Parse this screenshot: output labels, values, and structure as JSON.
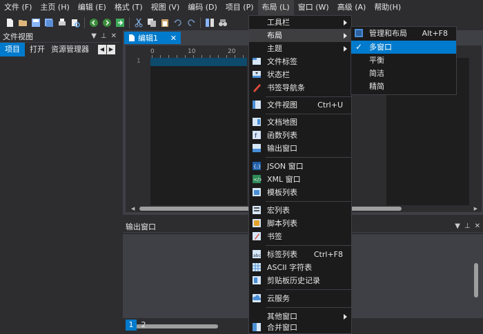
{
  "menubar": [
    {
      "label": "文件 (F)"
    },
    {
      "label": "主页 (H)"
    },
    {
      "label": "编辑 (E)"
    },
    {
      "label": "格式 (T)"
    },
    {
      "label": "视图 (V)"
    },
    {
      "label": "编码 (D)"
    },
    {
      "label": "项目 (P)"
    },
    {
      "label": "布局 (L)"
    },
    {
      "label": "窗口 (W)"
    },
    {
      "label": "高级 (A)"
    },
    {
      "label": "帮助(H)"
    }
  ],
  "file_view": {
    "title": "文件视图",
    "tabs": [
      "项目",
      "打开",
      "资源管理器"
    ]
  },
  "editor": {
    "tab_label": "编辑1",
    "ruler": [
      "0",
      "10",
      "20"
    ],
    "line_numbers": [
      "1"
    ]
  },
  "output": {
    "title": "输出窗口",
    "tabs": [
      "1",
      "2"
    ]
  },
  "layout_menu": {
    "items": [
      {
        "label": "工具栏",
        "shortcut": "",
        "submenu": true,
        "icon": "none"
      },
      {
        "label": "布局",
        "shortcut": "",
        "submenu": true,
        "icon": "none"
      },
      {
        "label": "主题",
        "shortcut": "",
        "submenu": true,
        "icon": "none"
      },
      {
        "label": "文件标签",
        "shortcut": "",
        "submenu": false,
        "icon": "file-tabs-icon"
      },
      {
        "label": "状态栏",
        "shortcut": "",
        "submenu": false,
        "icon": "status-bar-icon"
      },
      {
        "label": "书签导航条",
        "shortcut": "",
        "submenu": false,
        "icon": "bookmark-nav-icon"
      },
      {
        "label": "文件视图",
        "shortcut": "Ctrl+U",
        "submenu": false,
        "icon": "file-view-icon"
      },
      {
        "label": "文档地图",
        "shortcut": "",
        "submenu": false,
        "icon": "document-map-icon"
      },
      {
        "label": "函数列表",
        "shortcut": "",
        "submenu": false,
        "icon": "function-list-icon"
      },
      {
        "label": "输出窗口",
        "shortcut": "",
        "submenu": false,
        "icon": "output-window-icon"
      },
      {
        "label": "JSON 窗口",
        "shortcut": "",
        "submenu": false,
        "icon": "json-icon"
      },
      {
        "label": "XML 窗口",
        "shortcut": "",
        "submenu": false,
        "icon": "xml-icon"
      },
      {
        "label": "模板列表",
        "shortcut": "",
        "submenu": false,
        "icon": "template-list-icon"
      },
      {
        "label": "宏列表",
        "shortcut": "",
        "submenu": false,
        "icon": "macro-list-icon"
      },
      {
        "label": "脚本列表",
        "shortcut": "",
        "submenu": false,
        "icon": "script-list-icon"
      },
      {
        "label": "书签",
        "shortcut": "",
        "submenu": false,
        "icon": "bookmark-icon"
      },
      {
        "label": "标签列表",
        "shortcut": "Ctrl+F8",
        "submenu": false,
        "icon": "tag-list-icon"
      },
      {
        "label": "ASCII 字符表",
        "shortcut": "",
        "submenu": false,
        "icon": "ascii-table-icon"
      },
      {
        "label": "剪贴板历史记录",
        "shortcut": "",
        "submenu": false,
        "icon": "clipboard-history-icon"
      },
      {
        "label": "云服务",
        "shortcut": "",
        "submenu": false,
        "icon": "cloud-service-icon"
      },
      {
        "label": "其他窗口",
        "shortcut": "",
        "submenu": true,
        "icon": "none"
      },
      {
        "label": "合并窗口",
        "shortcut": "",
        "submenu": false,
        "icon": "merge-window-icon"
      }
    ]
  },
  "layout_submenu": {
    "items": [
      {
        "label": "管理和布局",
        "shortcut": "Alt+F8",
        "checked": false,
        "icon": "manage-layout-icon"
      },
      {
        "label": "多窗口",
        "shortcut": "",
        "checked": true,
        "icon": "none"
      },
      {
        "label": "平衡",
        "shortcut": "",
        "checked": false,
        "icon": "none"
      },
      {
        "label": "简洁",
        "shortcut": "",
        "checked": false,
        "icon": "none"
      },
      {
        "label": "精简",
        "shortcut": "",
        "checked": false,
        "icon": "none"
      }
    ]
  },
  "colors": {
    "accent": "#007acc",
    "background": "#2d2d30",
    "menu_bg": "#1b1b1c",
    "editor_bg": "#1e1e1e"
  }
}
